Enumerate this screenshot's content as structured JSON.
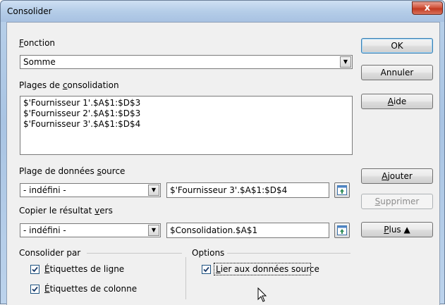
{
  "window": {
    "title": "Consolider",
    "close_label": "x"
  },
  "function": {
    "label_first": "F",
    "label_rest": "onction",
    "selected": "Somme"
  },
  "ranges": {
    "label_pre": "Plages de ",
    "label_u": "c",
    "label_post": "onsolidation",
    "items": [
      "$'Fournisseur 1'.$A$1:$D$3",
      "$'Fournisseur 2'.$A$1:$D$3",
      "$'Fournisseur 3'.$A$1:$D$4"
    ]
  },
  "source": {
    "label_pre": "Plage de données ",
    "label_u": "s",
    "label_post": "ource",
    "combo_value": "- indéfini -",
    "field_value": "$'Fournisseur 3'.$A$1:$D$4"
  },
  "copy_to": {
    "label_pre": "Copier le résultat ",
    "label_u": "v",
    "label_post": "ers",
    "combo_value": "- indéfini -",
    "field_value": "$Consolidation.$A$1"
  },
  "consolidate_by": {
    "title": "Consolider par",
    "row_labels_u": "É",
    "row_labels_rest": "tiquettes de ligne",
    "col_labels_u": "É",
    "col_labels_rest": "tiquettes de colonne"
  },
  "options": {
    "title": "Options",
    "link_u": "L",
    "link_rest": "ier aux données source"
  },
  "buttons": {
    "ok": "OK",
    "cancel": "Annuler",
    "help_u": "A",
    "help_rest": "ide",
    "add_u": "A",
    "add_rest": "jouter",
    "remove_u": "S",
    "remove_rest": "upprimer",
    "more_u": "P",
    "more_rest": "lus",
    "more_arrow": "▲"
  }
}
